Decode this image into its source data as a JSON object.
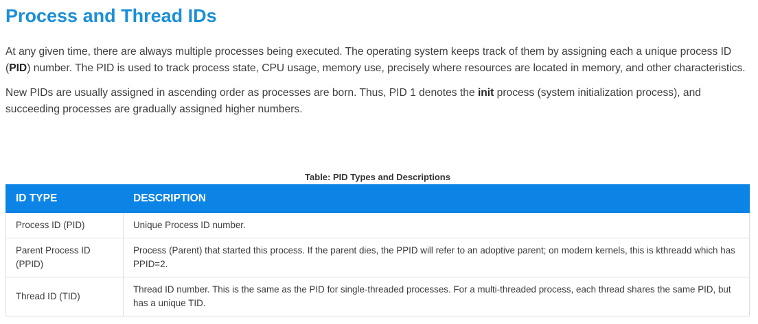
{
  "heading": "Process and Thread IDs",
  "paragraph1": {
    "before": "At any given time, there are always multiple processes being executed. The operating system keeps track of them by assigning each a unique process ID (",
    "bold": "PID",
    "after": ") number. The PID is used to track process state, CPU usage, memory use, precisely where resources are located in memory, and other characteristics."
  },
  "paragraph2": {
    "before": "New PIDs are usually assigned in ascending order as processes are born. Thus, PID 1 denotes the ",
    "bold": "init",
    "after": " process (system initialization process), and succeeding processes are gradually assigned higher numbers."
  },
  "table": {
    "caption": "Table: PID Types and Descriptions",
    "headers": [
      "ID TYPE",
      "DESCRIPTION"
    ],
    "rows": [
      {
        "id_type": "Process ID (PID)",
        "description": "Unique Process ID number."
      },
      {
        "id_type": "Parent Process ID (PPID)",
        "description": "Process (Parent) that started this process. If the parent dies, the PPID will refer to an adoptive parent; on modern kernels, this is kthreadd which has PPID=2."
      },
      {
        "id_type": "Thread ID (TID)",
        "description": "Thread ID number. This is the same as the PID for single-threaded processes. For a multi-threaded process, each thread shares the same PID, but has a unique TID."
      }
    ]
  },
  "colors": {
    "heading": "#1a8fd8",
    "table_header_bg": "#0b84e6",
    "table_header_text": "#ffffff"
  }
}
